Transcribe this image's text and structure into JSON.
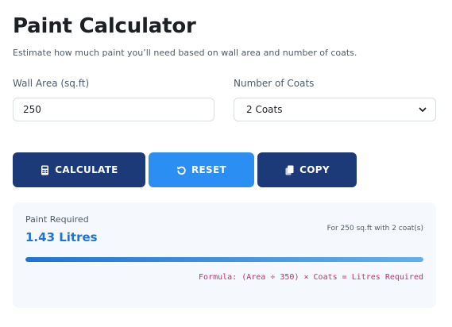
{
  "page": {
    "title": "Paint Calculator",
    "subtitle": "Estimate how much paint you’ll need based on wall area and number of coats."
  },
  "form": {
    "area_label": "Wall Area (sq.ft)",
    "area_value": "250",
    "coats_label": "Number of Coats",
    "coats_selected": "2 Coats"
  },
  "buttons": {
    "calculate": "CALCULATE",
    "reset": "RESET",
    "copy": "COPY"
  },
  "result": {
    "label": "Paint Required",
    "value": "1.43 Litres",
    "note": "For 250 sq.ft with 2 coat(s)",
    "progress": 1.0,
    "formula": "Formula: (Area ÷ 350) × Coats = Litres Required"
  },
  "icons": {
    "calculate": "calculator-icon",
    "reset": "reset-icon",
    "copy": "copy-icon",
    "select": "chevron-down-icon"
  },
  "colors": {
    "primary_dark": "#1d3a78",
    "primary_light": "#2b8ef2",
    "result_value": "#1e73d8",
    "formula": "#c42d6f",
    "result_bg": "#f5f8fd"
  }
}
